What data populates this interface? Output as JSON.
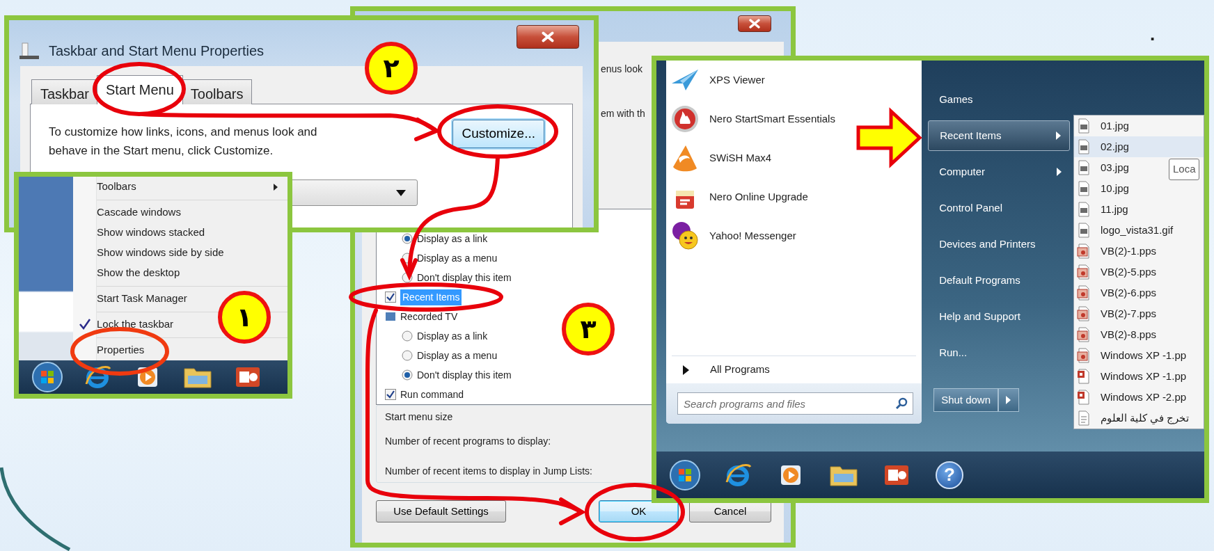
{
  "slide": {
    "mark": "."
  },
  "steps": [
    {
      "number": "١"
    },
    {
      "number": "٢"
    },
    {
      "number": "٣"
    }
  ],
  "customize_dialog": {
    "partial_lines": [
      "enus look",
      "em with th"
    ],
    "options": [
      {
        "kind": "radio",
        "label": "Display as a link",
        "selected": true
      },
      {
        "kind": "radio",
        "label": "Display as a menu",
        "selected": false
      },
      {
        "kind": "radio",
        "label": "Don't display this item",
        "selected": false
      },
      {
        "kind": "checkbox",
        "label": "Recent Items",
        "checked": true,
        "highlighted": true
      },
      {
        "kind": "category",
        "label": "Recorded TV"
      },
      {
        "kind": "radio",
        "label": "Display as a link",
        "selected": false
      },
      {
        "kind": "radio",
        "label": "Display as a menu",
        "selected": false
      },
      {
        "kind": "radio",
        "label": "Don't display this item",
        "selected": true
      },
      {
        "kind": "checkbox",
        "label": "Run command",
        "checked": true,
        "highlighted": false
      }
    ],
    "size_section": {
      "title": "Start menu size",
      "rows": [
        "Number of recent programs to display:",
        "Number of recent items to display in Jump Lists:"
      ]
    },
    "buttons": [
      {
        "label": "Use Default Settings",
        "default": false
      },
      {
        "label": "OK",
        "default": true
      },
      {
        "label": "Cancel",
        "default": false
      }
    ]
  },
  "properties_dialog": {
    "title": "Taskbar and Start Menu Properties",
    "tabs": [
      {
        "label": "Taskbar",
        "selected": false
      },
      {
        "label": "Start Menu",
        "selected": true
      },
      {
        "label": "Toolbars",
        "selected": false
      }
    ],
    "description": "To customize how links, icons, and menus look and behave in the Start menu, click Customize.",
    "customize_button": "Customize..."
  },
  "taskbar_menu": {
    "groups": [
      {
        "items": [
          {
            "label": "Toolbars",
            "submenu": true,
            "checked": false
          }
        ]
      },
      {
        "items": [
          {
            "label": "Cascade windows",
            "submenu": false,
            "checked": false
          },
          {
            "label": "Show windows stacked",
            "submenu": false,
            "checked": false
          },
          {
            "label": "Show windows side by side",
            "submenu": false,
            "checked": false
          },
          {
            "label": "Show the desktop",
            "submenu": false,
            "checked": false
          }
        ]
      },
      {
        "items": [
          {
            "label": "Start Task Manager",
            "submenu": false,
            "checked": false
          }
        ]
      },
      {
        "items": [
          {
            "label": "Lock the taskbar",
            "submenu": false,
            "checked": true
          }
        ]
      },
      {
        "items": [
          {
            "label": "Properties",
            "submenu": false,
            "checked": false
          }
        ]
      }
    ]
  },
  "start_menu": {
    "programs": [
      {
        "label": "XPS Viewer",
        "kind": "xps"
      },
      {
        "label": "Nero StartSmart Essentials",
        "kind": "nero"
      },
      {
        "label": "SWiSH Max4",
        "kind": "swish"
      },
      {
        "label": "Nero Online Upgrade",
        "kind": "upgrade"
      },
      {
        "label": "Yahoo! Messenger",
        "kind": "messenger"
      }
    ],
    "all_programs": "All Programs",
    "search": {
      "placeholder": "Search programs and files"
    },
    "places": [
      {
        "label": "Games",
        "submenu": false,
        "selected": false
      },
      {
        "label": "Recent Items",
        "submenu": true,
        "selected": true
      },
      {
        "label": "Computer",
        "submenu": true,
        "selected": false
      },
      {
        "label": "Control Panel",
        "submenu": false,
        "selected": false
      },
      {
        "label": "Devices and Printers",
        "submenu": false,
        "selected": false
      },
      {
        "label": "Default Programs",
        "submenu": false,
        "selected": false
      },
      {
        "label": "Help and Support",
        "submenu": false,
        "selected": false
      },
      {
        "label": "Run...",
        "submenu": false,
        "selected": false
      }
    ],
    "shutdown": "Shut down",
    "recent_items": [
      {
        "label": "01.jpg",
        "kind": "image",
        "selected": false
      },
      {
        "label": "02.jpg",
        "kind": "image",
        "selected": true
      },
      {
        "label": "03.jpg",
        "kind": "image",
        "selected": false
      },
      {
        "label": "10.jpg",
        "kind": "image",
        "selected": false
      },
      {
        "label": "11.jpg",
        "kind": "image",
        "selected": false
      },
      {
        "label": "logo_vista31.gif",
        "kind": "image",
        "selected": false
      },
      {
        "label": "VB(2)-1.pps",
        "kind": "slideshow",
        "selected": false
      },
      {
        "label": "VB(2)-5.pps",
        "kind": "slideshow",
        "selected": false
      },
      {
        "label": "VB(2)-6.pps",
        "kind": "slideshow",
        "selected": false
      },
      {
        "label": "VB(2)-7.pps",
        "kind": "slideshow",
        "selected": false
      },
      {
        "label": "VB(2)-8.pps",
        "kind": "slideshow",
        "selected": false
      },
      {
        "label": "Windows XP -1.pp",
        "kind": "slideshow",
        "selected": false
      },
      {
        "label": "Windows XP -1.pp",
        "kind": "presentation",
        "selected": false
      },
      {
        "label": "Windows XP -2.pp",
        "kind": "presentation",
        "selected": false
      },
      {
        "label": "تخرج في كلية العلوم",
        "kind": "document",
        "selected": false
      }
    ],
    "tooltip": "Loca",
    "help_glyph": "?"
  }
}
